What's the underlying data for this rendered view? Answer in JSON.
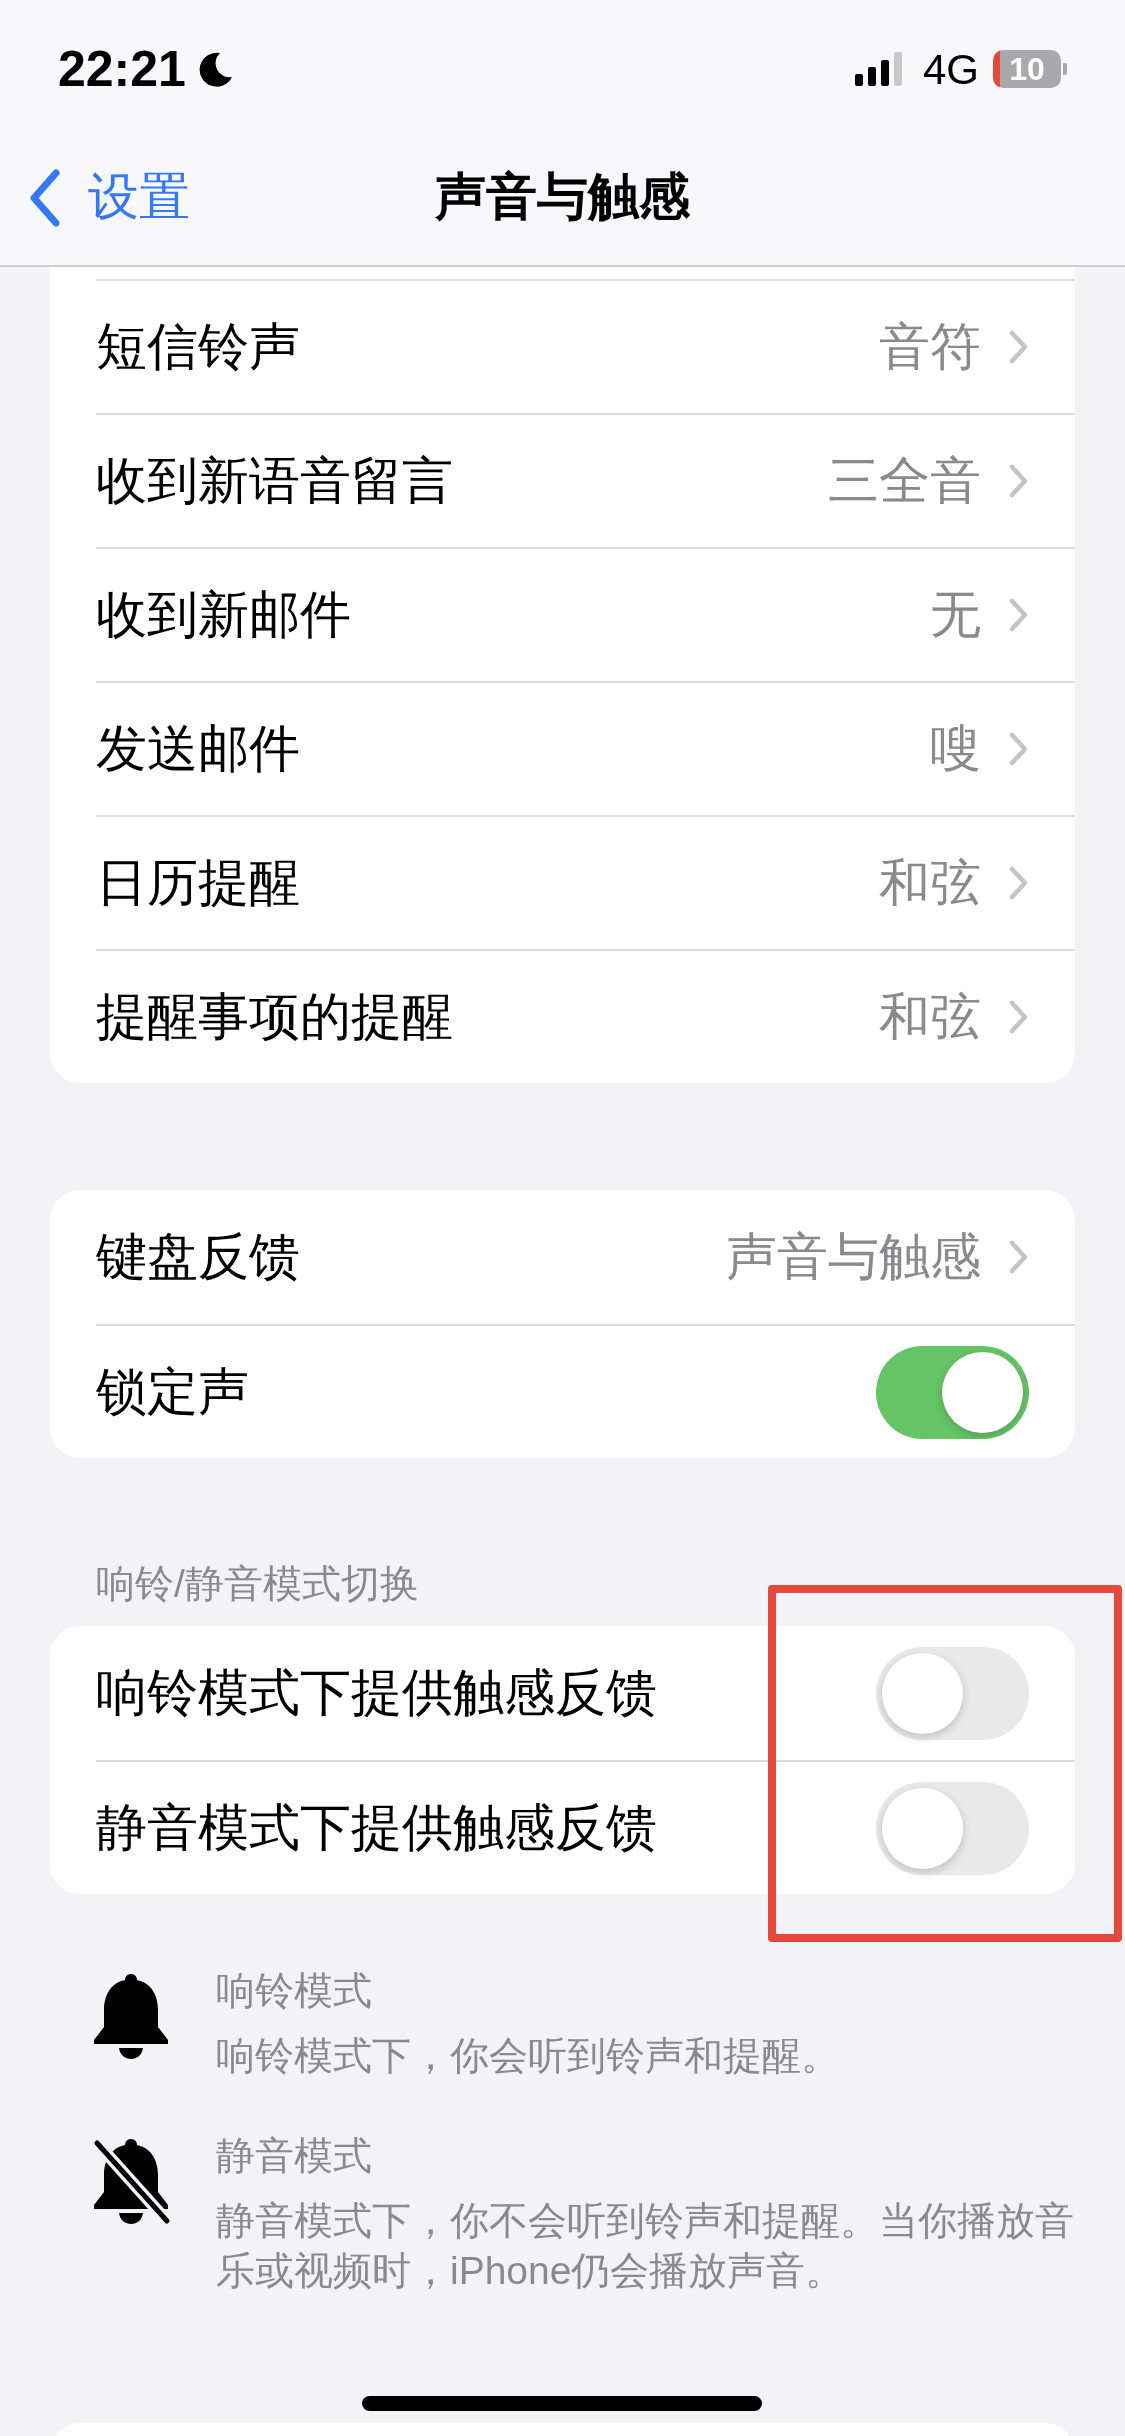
{
  "status_bar": {
    "time": "22:21",
    "network": "4G",
    "battery": "10"
  },
  "nav": {
    "back": "设置",
    "title": "声音与触感"
  },
  "groups": [
    {
      "rows": [
        {
          "kind": "link",
          "label": "短信铃声",
          "value": "音符"
        },
        {
          "kind": "link",
          "label": "收到新语音留言",
          "value": "三全音"
        },
        {
          "kind": "link",
          "label": "收到新邮件",
          "value": "无"
        },
        {
          "kind": "link",
          "label": "发送邮件",
          "value": "嗖"
        },
        {
          "kind": "link",
          "label": "日历提醒",
          "value": "和弦"
        },
        {
          "kind": "link",
          "label": "提醒事项的提醒",
          "value": "和弦"
        }
      ]
    },
    {
      "rows": [
        {
          "kind": "link",
          "label": "键盘反馈",
          "value": "声音与触感"
        },
        {
          "kind": "toggle",
          "label": "锁定声",
          "on": true
        }
      ]
    },
    {
      "header": "响铃/静音模式切换",
      "rows": [
        {
          "kind": "toggle",
          "label": "响铃模式下提供触感反馈",
          "on": false
        },
        {
          "kind": "toggle",
          "label": "静音模式下提供触感反馈",
          "on": false
        }
      ]
    }
  ],
  "modes": [
    {
      "kind": "ring",
      "title": "响铃模式",
      "description": "响铃模式下，你会听到铃声和提醒。"
    },
    {
      "kind": "silent",
      "title": "静音模式",
      "description": "静音模式下，你不会听到铃声和提醒。当你播放音乐或视频时，iPhone仍会播放声音。"
    }
  ]
}
